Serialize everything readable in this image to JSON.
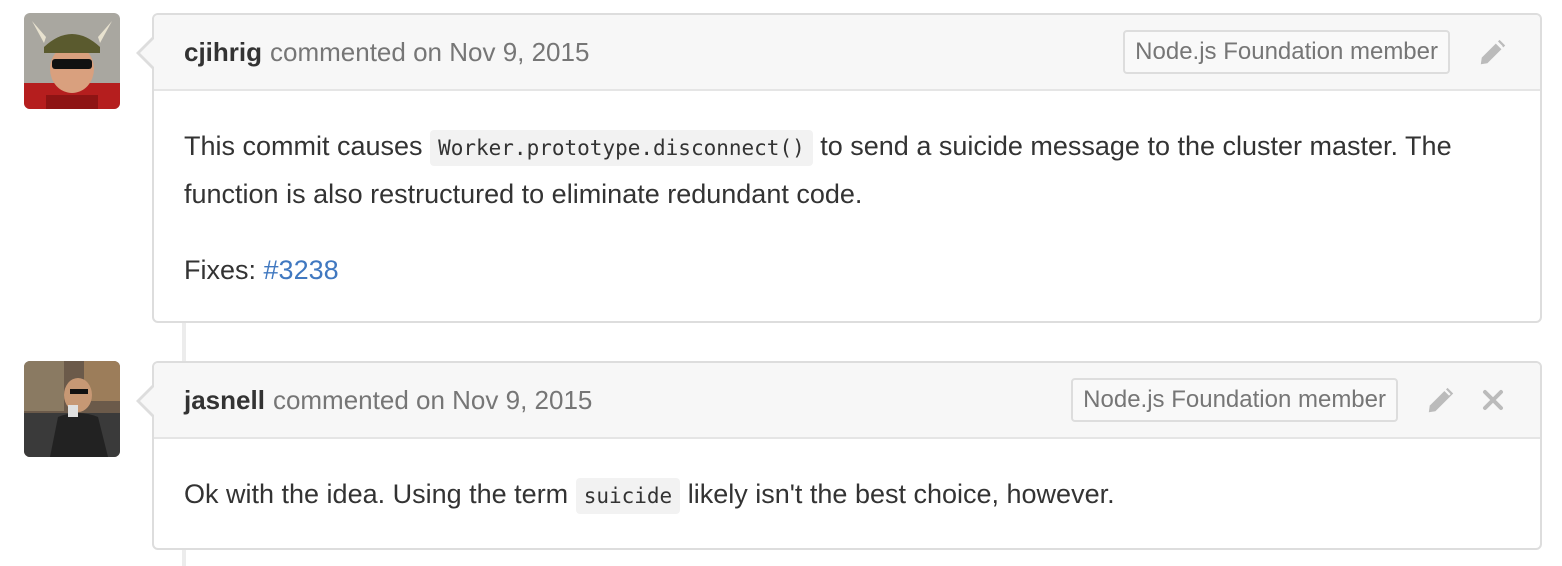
{
  "comments": [
    {
      "author": "cjihrig",
      "action": "commented on",
      "date": "Nov 9, 2015",
      "badge": "Node.js Foundation member",
      "body": {
        "p1_before": "This commit causes",
        "p1_code": "Worker.prototype.disconnect()",
        "p1_after": "to send a suicide message to the cluster master. The function is also restructured to eliminate redundant code.",
        "p2_label": "Fixes:",
        "p2_link": "#3238"
      }
    },
    {
      "author": "jasnell",
      "action": "commented on",
      "date": "Nov 9, 2015",
      "badge": "Node.js Foundation member",
      "body": {
        "before": "Ok with the idea. Using the term",
        "code": "suicide",
        "after": "likely isn't the best choice, however."
      }
    }
  ],
  "colors": {
    "link": "#4078c0",
    "header_bg": "#f7f7f7",
    "border": "#dddddd",
    "muted_text": "#767676"
  },
  "icons": [
    "pencil-icon",
    "close-icon"
  ]
}
